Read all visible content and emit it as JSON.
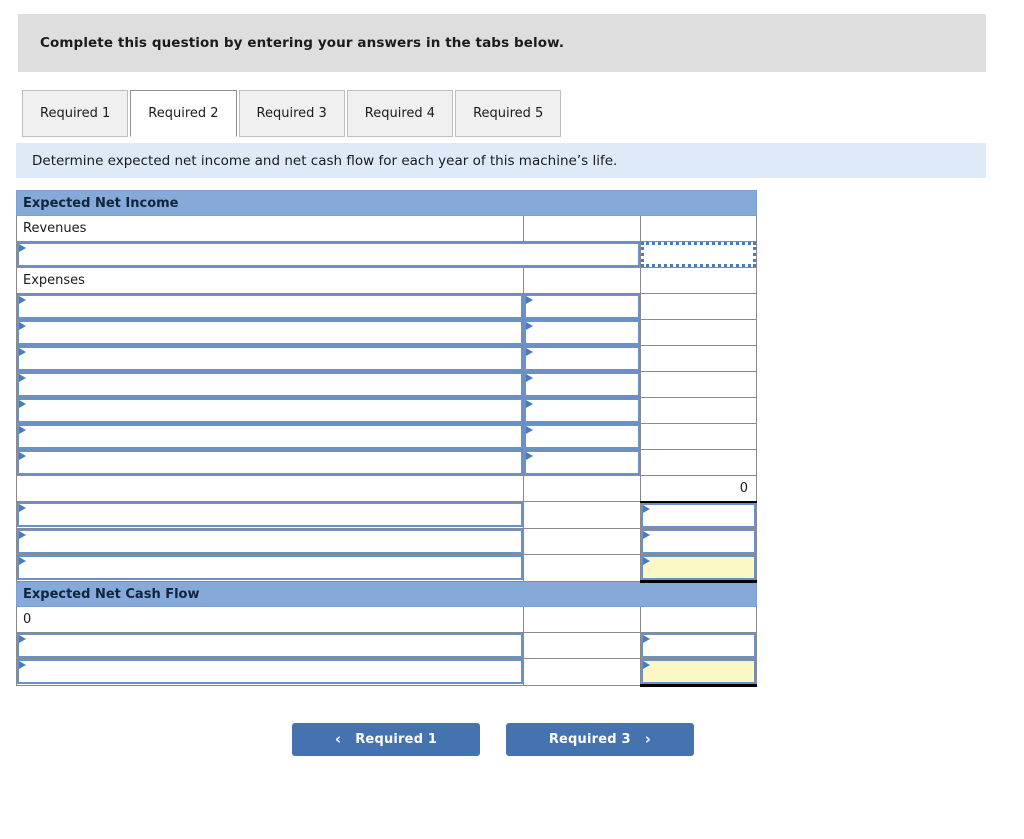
{
  "banner": {
    "text": "Complete this question by entering your answers in the tabs below."
  },
  "tabs": [
    {
      "label": "Required 1",
      "active": false
    },
    {
      "label": "Required 2",
      "active": true
    },
    {
      "label": "Required 3",
      "active": false
    },
    {
      "label": "Required 4",
      "active": false
    },
    {
      "label": "Required 5",
      "active": false
    }
  ],
  "requirement": {
    "text": "Determine expected net income and net cash flow for each year of this machine’s life."
  },
  "sheet": {
    "net_income_header": "Expected Net Income",
    "revenues_label": "Revenues",
    "expenses_label": "Expenses",
    "net_cash_flow_header": "Expected Net Cash Flow",
    "expense_rows": 7,
    "subtotal_value": "0",
    "cash_flow_start_value": "0",
    "empty_value": ""
  },
  "colors": {
    "section_header": "#85a9d9",
    "entry_border": "#6b92c8",
    "highlight_cell": "#fbf8c5",
    "button": "#4573b0",
    "banner_gray": "#dededf",
    "requirement_blue": "#deeaf7"
  },
  "nav": {
    "prev": {
      "label": "Required 1",
      "icon": "chevron-left-icon",
      "glyph": "‹"
    },
    "next": {
      "label": "Required 3",
      "icon": "chevron-right-icon",
      "glyph": "›"
    }
  }
}
